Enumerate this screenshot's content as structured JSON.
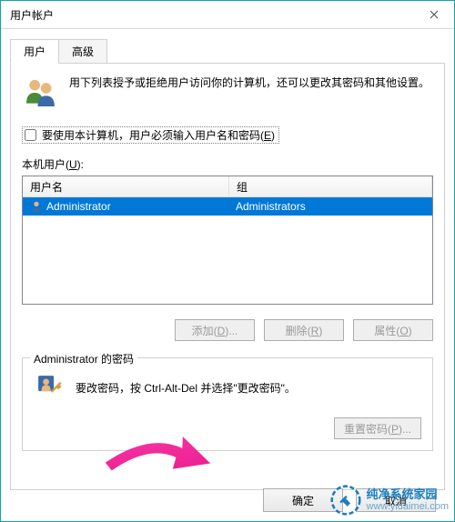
{
  "window": {
    "title": "用户帐户"
  },
  "tabs": {
    "users": "用户",
    "advanced": "高级"
  },
  "info": {
    "text": "用下列表授予或拒绝用户访问你的计算机，还可以更改其密码和其他设置。"
  },
  "checkbox": {
    "label_pre": "要使用本计算机，用户必须输入用户名和密码(",
    "label_mnemonic": "E",
    "label_post": ")"
  },
  "section": {
    "label_pre": "本机用户(",
    "label_mnemonic": "U",
    "label_post": "):"
  },
  "table": {
    "header_name": "用户名",
    "header_group": "组",
    "rows": [
      {
        "name": "Administrator",
        "group": "Administrators"
      }
    ]
  },
  "buttons": {
    "add_pre": "添加(",
    "add_m": "D",
    "add_post": ")...",
    "remove_pre": "删除(",
    "remove_m": "R",
    "remove_post": ")",
    "prop_pre": "属性(",
    "prop_m": "O",
    "prop_post": ")"
  },
  "pwgroup": {
    "legend": "Administrator 的密码",
    "text": "要改密码，按 Ctrl-Alt-Del 并选择\"更改密码\"。",
    "reset_pre": "重置密码(",
    "reset_m": "P",
    "reset_post": ")..."
  },
  "dialog": {
    "ok": "确定",
    "cancel": "取消"
  },
  "watermark": {
    "line1": "纯净系统家园",
    "line2": "www.yidaimei.com"
  }
}
